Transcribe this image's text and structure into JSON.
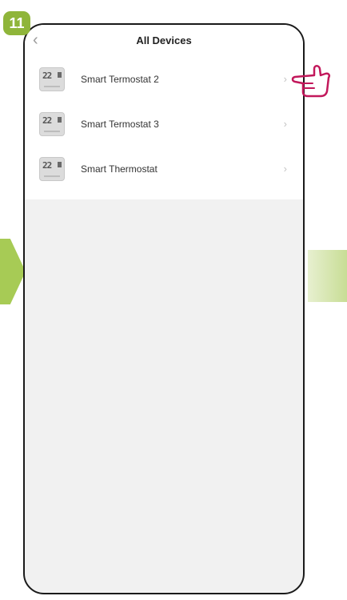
{
  "step": {
    "number": "11"
  },
  "header": {
    "title": "All Devices"
  },
  "devices": [
    {
      "name": "Smart Termostat 2",
      "display": "22"
    },
    {
      "name": "Smart Termostat 3",
      "display": "22"
    },
    {
      "name": "Smart Thermostat",
      "display": "22"
    }
  ],
  "colors": {
    "accent": "#8fb53a",
    "pointer": "#c2185b",
    "background": "#f1f1f1"
  },
  "icons": {
    "back": "back-arrow-icon",
    "row_action": "chevron-right-icon",
    "pointer": "hand-pointer-icon",
    "device": "thermostat-icon"
  }
}
